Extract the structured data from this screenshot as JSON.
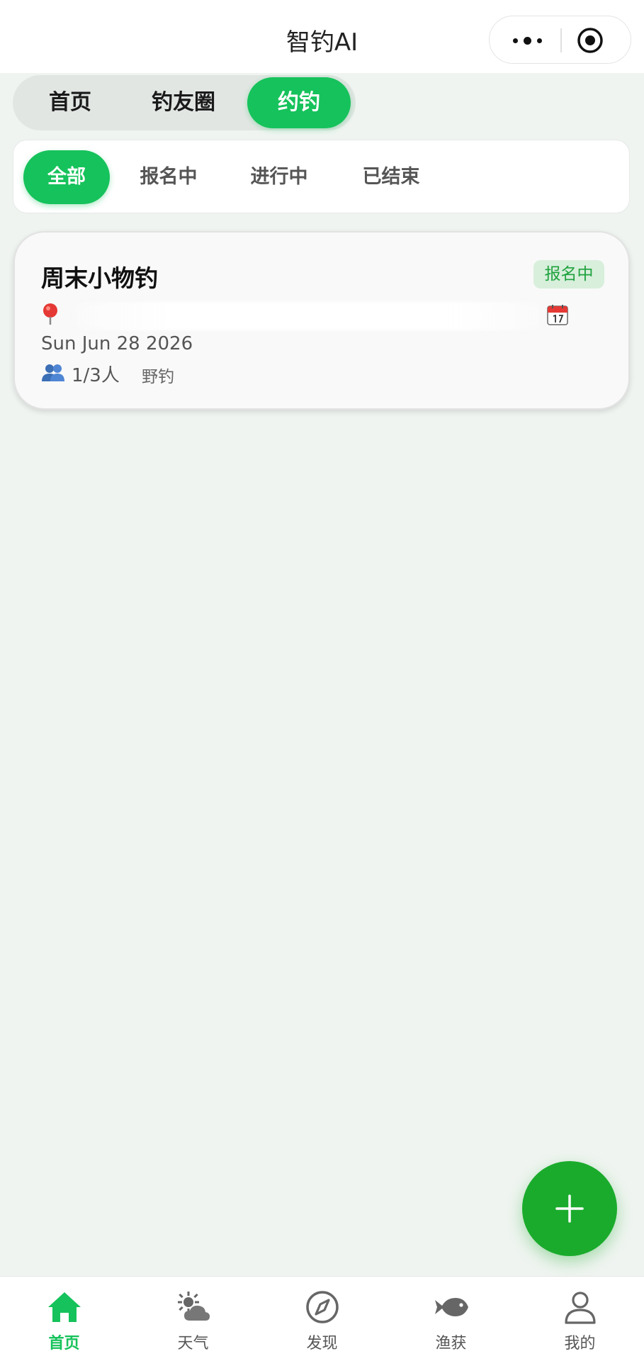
{
  "header": {
    "title": "智钓AI",
    "more_icon": "more-dots-icon",
    "close_icon": "target-close-icon"
  },
  "main_tabs": [
    {
      "label": "首页",
      "active": false
    },
    {
      "label": "钓友圈",
      "active": false
    },
    {
      "label": "约钓",
      "active": true
    }
  ],
  "filters": [
    {
      "label": "全部",
      "active": true
    },
    {
      "label": "报名中",
      "active": false
    },
    {
      "label": "进行中",
      "active": false
    },
    {
      "label": "已结束",
      "active": false
    }
  ],
  "events": [
    {
      "title": "周末小物钓",
      "status": "报名中",
      "location": "",
      "date": "Sun Jun 28 2026",
      "people": "1/3人",
      "type": "野钓"
    }
  ],
  "fab": {
    "icon": "plus-icon"
  },
  "tabbar": [
    {
      "label": "首页",
      "icon": "home-icon",
      "active": true
    },
    {
      "label": "天气",
      "icon": "weather-icon",
      "active": false
    },
    {
      "label": "发现",
      "icon": "compass-icon",
      "active": false
    },
    {
      "label": "渔获",
      "icon": "fish-icon",
      "active": false
    },
    {
      "label": "我的",
      "icon": "profile-icon",
      "active": false
    }
  ],
  "colors": {
    "primary": "#16c25b",
    "fab": "#1aab2c",
    "background": "#eff4f0",
    "badge_bg": "#d8efdc",
    "badge_text": "#1fa23e"
  }
}
